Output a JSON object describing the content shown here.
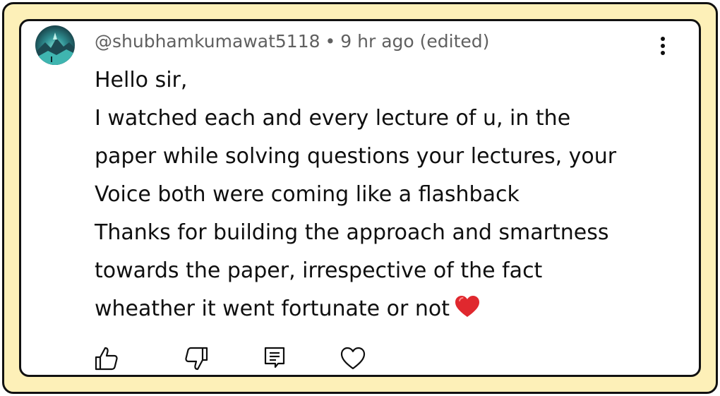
{
  "comment": {
    "author": "@shubhamkumawat5118",
    "separator": "•",
    "time": "9 hr ago (edited)",
    "lines": [
      "Hello sir,",
      "I watched each and every lecture of u, in the",
      "paper while solving questions your lectures, your",
      "Voice both were coming like a flashback",
      "Thanks for building the approach and smartness",
      "towards the paper, irrespective of the fact",
      "wheather it went fortunate or not"
    ],
    "trailing_emoji": "red-heart"
  },
  "icons": {
    "avatar": "avatar-image",
    "menu": "more-vert-icon",
    "like": "thumbs-up-icon",
    "dislike": "thumbs-down-icon",
    "reply": "reply-comment-icon",
    "heart": "heart-outline-icon"
  },
  "colors": {
    "frame_bg": "#fdf0b8",
    "card_bg": "#ffffff",
    "border": "#111111",
    "meta_text": "#606060",
    "body_text": "#0f0f0f",
    "heart_emoji": "#e0282e"
  }
}
